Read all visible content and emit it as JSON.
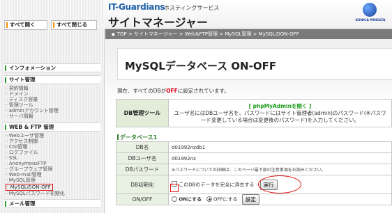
{
  "header": {
    "brand": "IT-Guardians",
    "brand_sub": "ホスティングサービス",
    "title": "サイトマネージャー",
    "maker": "KONICA MINOLTA"
  },
  "breadcrumb": "TOP > サイトマネージャー > Web&FTP管理 > MySQL管理 > MySQLのON-OFF",
  "sidebar": {
    "open_all": "すべて開く",
    "close_all": "すべて閉じる",
    "sections": {
      "info": "インフォメーション",
      "site": "サイト管理",
      "webftp": "WEB & FTP 管理",
      "mail": "メール管理"
    },
    "site_items": [
      "契約情報",
      "ドメイン",
      "ディスク容量",
      "管理ツール",
      "adminアカウント管理",
      "サーバ情報"
    ],
    "webftp_items": [
      "Webユーザ管理",
      "アクセス制御",
      "CGI管理",
      "ログファイル",
      "SSL",
      "AnonymousFTP",
      "グループウェア管理",
      "Web-mail管理",
      "MySQL管理",
      "MySQLのON-OFF",
      "MySQLパスワード初期化"
    ]
  },
  "main": {
    "title": "MySQLデータベース ON-OFF",
    "status_prefix": "現在、すべてのDBが",
    "status_off": "OFF",
    "status_suffix": "に設定されています。",
    "tool": {
      "label": "DB管理ツール",
      "link": "[ phpMyAdminを開く ]",
      "desc": "ユーザ名にはDBユーザ名を、パスワードにはサイト管理者(admin)のパスワード(※パスワード変更している場合は変更後のパスワード)を入力してください。"
    },
    "db": {
      "heading": "データベース1",
      "rows": {
        "name_label": "DB名",
        "name_value": "d01992nzdb1",
        "user_label": "DBユーザ名",
        "user_value": "d01992nz",
        "pass_label": "DBパスワード",
        "pass_note": "※パスワードについての詳細は、このページ最下部の注意事項をお読みください。",
        "init_label": "DB初期化",
        "init_text": "このDBのデータを完全に消去する",
        "init_button": "実行",
        "onoff_label": "ON/OFF",
        "on_text": "ONにする",
        "off_text": "OFFにする",
        "set_button": "設定"
      }
    }
  },
  "colors": {
    "accent_green": "#2c7b2c",
    "alert_red": "#e0001a",
    "brand_blue": "#1e5fa8",
    "annotation": "#e01010"
  }
}
